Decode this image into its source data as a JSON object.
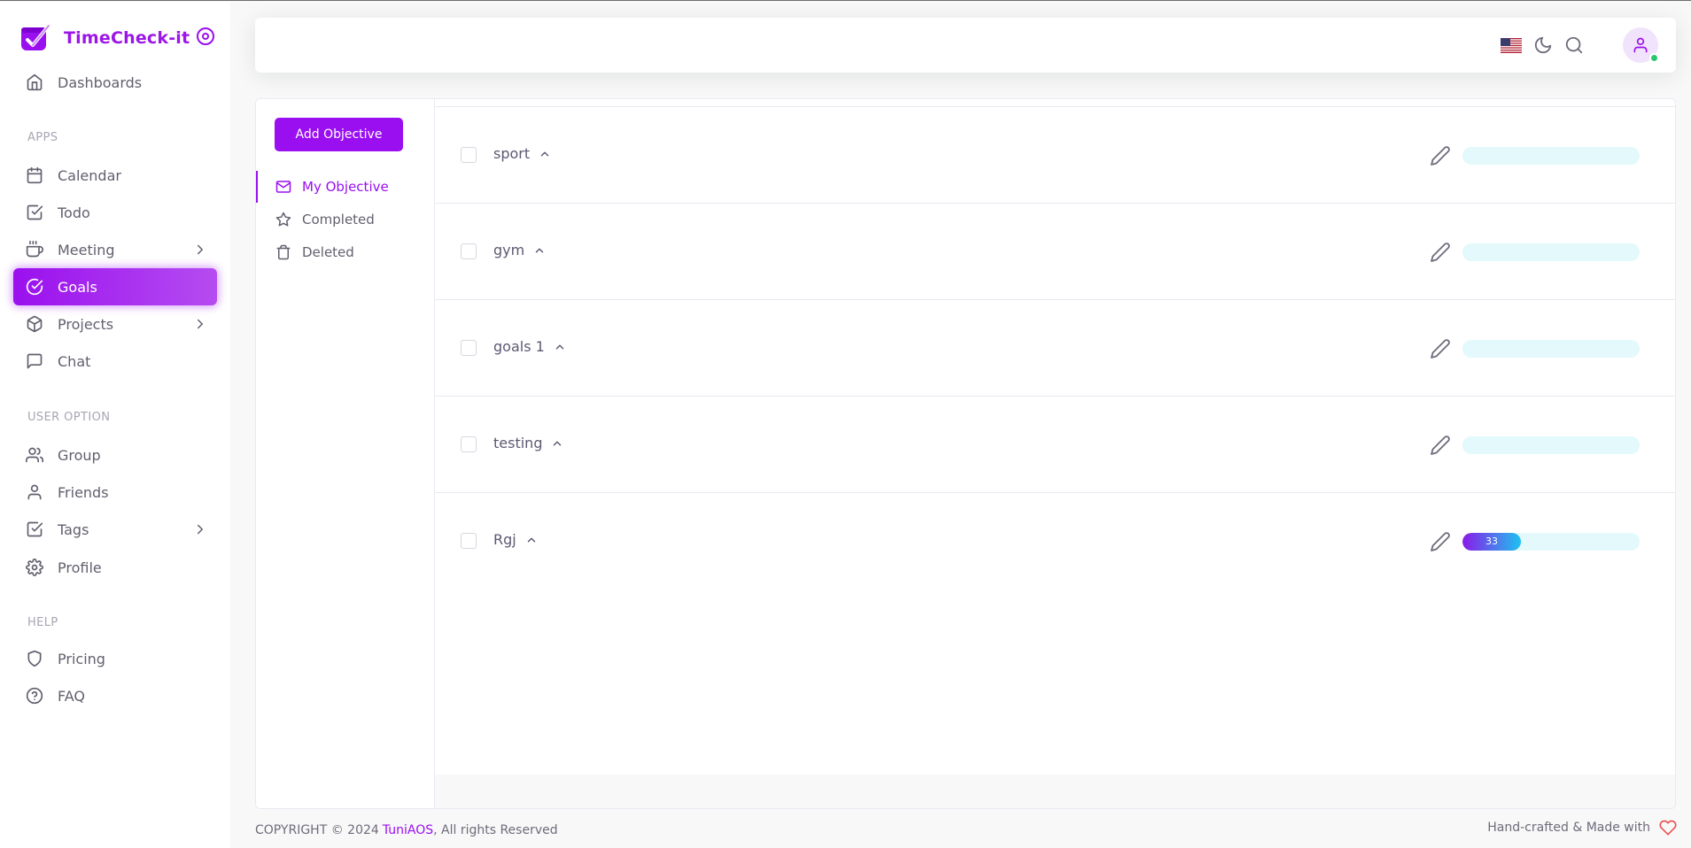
{
  "brand": {
    "name": "TimeCheck-it"
  },
  "sidebar": {
    "items": [
      {
        "label": "Dashboards"
      },
      {
        "header": "APPS"
      },
      {
        "label": "Calendar"
      },
      {
        "label": "Todo"
      },
      {
        "label": "Meeting"
      },
      {
        "label": "Goals"
      },
      {
        "label": "Projects"
      },
      {
        "label": "Chat"
      },
      {
        "header": "USER OPTION"
      },
      {
        "label": "Group"
      },
      {
        "label": "Friends"
      },
      {
        "label": "Tags"
      },
      {
        "label": "Profile"
      },
      {
        "header": "HELP"
      },
      {
        "label": "Pricing"
      },
      {
        "label": "FAQ"
      }
    ],
    "active": "Goals"
  },
  "navbar": {
    "icons": [
      "us-flag-icon",
      "moon-icon",
      "search-icon",
      "user-icon"
    ]
  },
  "goals": {
    "add_button": "Add Objective",
    "filters": [
      {
        "label": "My Objective",
        "icon": "mail-icon"
      },
      {
        "label": "Completed",
        "icon": "star-icon"
      },
      {
        "label": "Deleted",
        "icon": "trash-icon"
      }
    ],
    "active_filter": "My Objective",
    "items": [
      {
        "title": "sport",
        "progress": 0,
        "progress_label": ""
      },
      {
        "title": "gym",
        "progress": 0,
        "progress_label": ""
      },
      {
        "title": "goals 1",
        "progress": 0,
        "progress_label": ""
      },
      {
        "title": "testing",
        "progress": 0,
        "progress_label": ""
      },
      {
        "title": "Rgj",
        "progress": 33,
        "progress_label": "33"
      }
    ]
  },
  "footer": {
    "copyright": "COPYRIGHT © 2024",
    "company": "TuniAOS",
    "rights": ", All rights Reserved",
    "made_with": "Hand-crafted & Made with"
  },
  "colors": {
    "accent": "#9a0ff0",
    "progress_track": "#e3f9fc",
    "progress_start": "#8a1be8",
    "progress_end": "#1ec2f0",
    "online": "#28c76f"
  }
}
